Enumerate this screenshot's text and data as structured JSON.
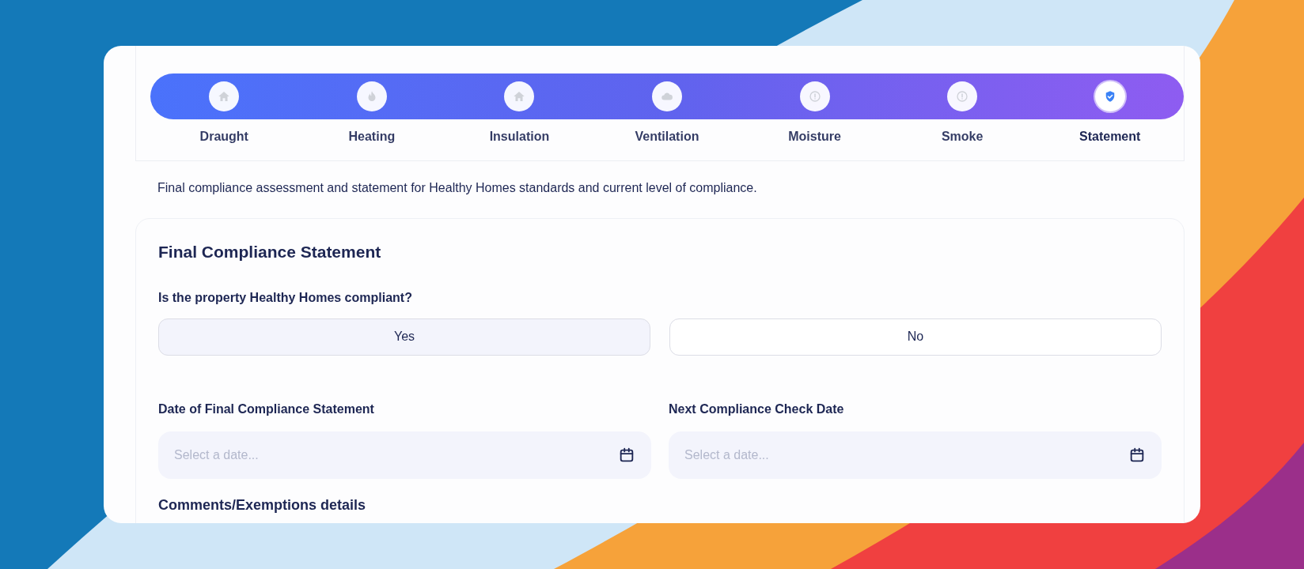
{
  "steps": [
    {
      "label": "Draught",
      "kind": "house",
      "selected": false
    },
    {
      "label": "Heating",
      "kind": "flame",
      "selected": false
    },
    {
      "label": "Insulation",
      "kind": "house",
      "selected": false
    },
    {
      "label": "Ventilation",
      "kind": "cloud",
      "selected": false
    },
    {
      "label": "Moisture",
      "kind": "alert",
      "selected": false
    },
    {
      "label": "Smoke",
      "kind": "alert",
      "selected": false
    },
    {
      "label": "Statement",
      "kind": "shield",
      "selected": true
    }
  ],
  "description": "Final compliance assessment and statement for Healthy Homes standards and current level of compliance.",
  "section": {
    "title": "Final Compliance Statement",
    "question": "Is the property Healthy Homes compliant?",
    "options": [
      {
        "label": "Yes",
        "selected": true
      },
      {
        "label": "No",
        "selected": false
      }
    ],
    "date_fields": [
      {
        "label": "Date of Final Compliance Statement",
        "placeholder": "Select a date..."
      },
      {
        "label": "Next Compliance Check Date",
        "placeholder": "Select a date..."
      }
    ],
    "comments_label": "Comments/Exemptions details"
  }
}
